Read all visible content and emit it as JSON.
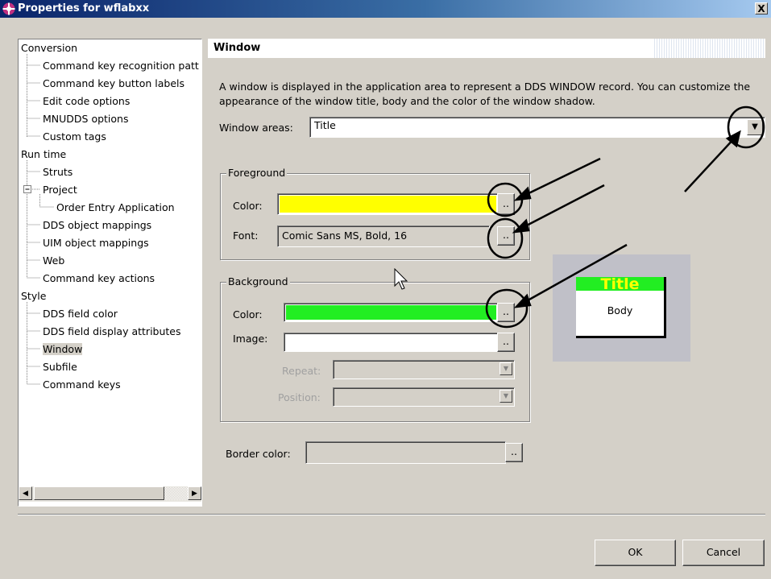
{
  "window": {
    "title": "Properties for wflabxx",
    "close_glyph": "X"
  },
  "tree": {
    "items": [
      {
        "label": "Conversion",
        "level": 0
      },
      {
        "label": "Command key recognition patt",
        "level": 1
      },
      {
        "label": "Command key button labels",
        "level": 1
      },
      {
        "label": "Edit code options",
        "level": 1
      },
      {
        "label": "MNUDDS options",
        "level": 1
      },
      {
        "label": "Custom tags",
        "level": 1
      },
      {
        "label": "Run time",
        "level": 0
      },
      {
        "label": "Struts",
        "level": 1
      },
      {
        "label": "Project",
        "level": 1,
        "expander": "−"
      },
      {
        "label": "Order Entry Application",
        "level": 2
      },
      {
        "label": "DDS object mappings",
        "level": 1
      },
      {
        "label": "UIM object mappings",
        "level": 1
      },
      {
        "label": "Web",
        "level": 1
      },
      {
        "label": "Command key actions",
        "level": 1
      },
      {
        "label": "Style",
        "level": 0
      },
      {
        "label": "DDS field color",
        "level": 1
      },
      {
        "label": "DDS field display attributes",
        "level": 1
      },
      {
        "label": "Window",
        "level": 1,
        "selected": true
      },
      {
        "label": "Subfile",
        "level": 1
      },
      {
        "label": "Command keys",
        "level": 1
      }
    ],
    "scroll_left_glyph": "◀",
    "scroll_right_glyph": "▶"
  },
  "page": {
    "header": "Window",
    "description": "A window is displayed in the application area to represent a DDS WINDOW record.  You can customize the appearance of the window title, body and the color of the window shadow.",
    "window_areas_label": "Window areas:",
    "window_areas_value": "Title"
  },
  "foreground": {
    "group_label": "Foreground",
    "color_label": "Color:",
    "color_value": "#ffff00",
    "font_label": "Font:",
    "font_value": "Comic Sans MS, Bold, 16"
  },
  "background": {
    "group_label": "Background",
    "color_label": "Color:",
    "color_value": "#22ee22",
    "image_label": "Image:",
    "image_value": "",
    "repeat_label": "Repeat:",
    "position_label": "Position:"
  },
  "border": {
    "label": "Border color:"
  },
  "browse_glyph": "..",
  "preview": {
    "title": "Title",
    "body": "Body"
  },
  "buttons": {
    "ok": "OK",
    "cancel": "Cancel"
  }
}
